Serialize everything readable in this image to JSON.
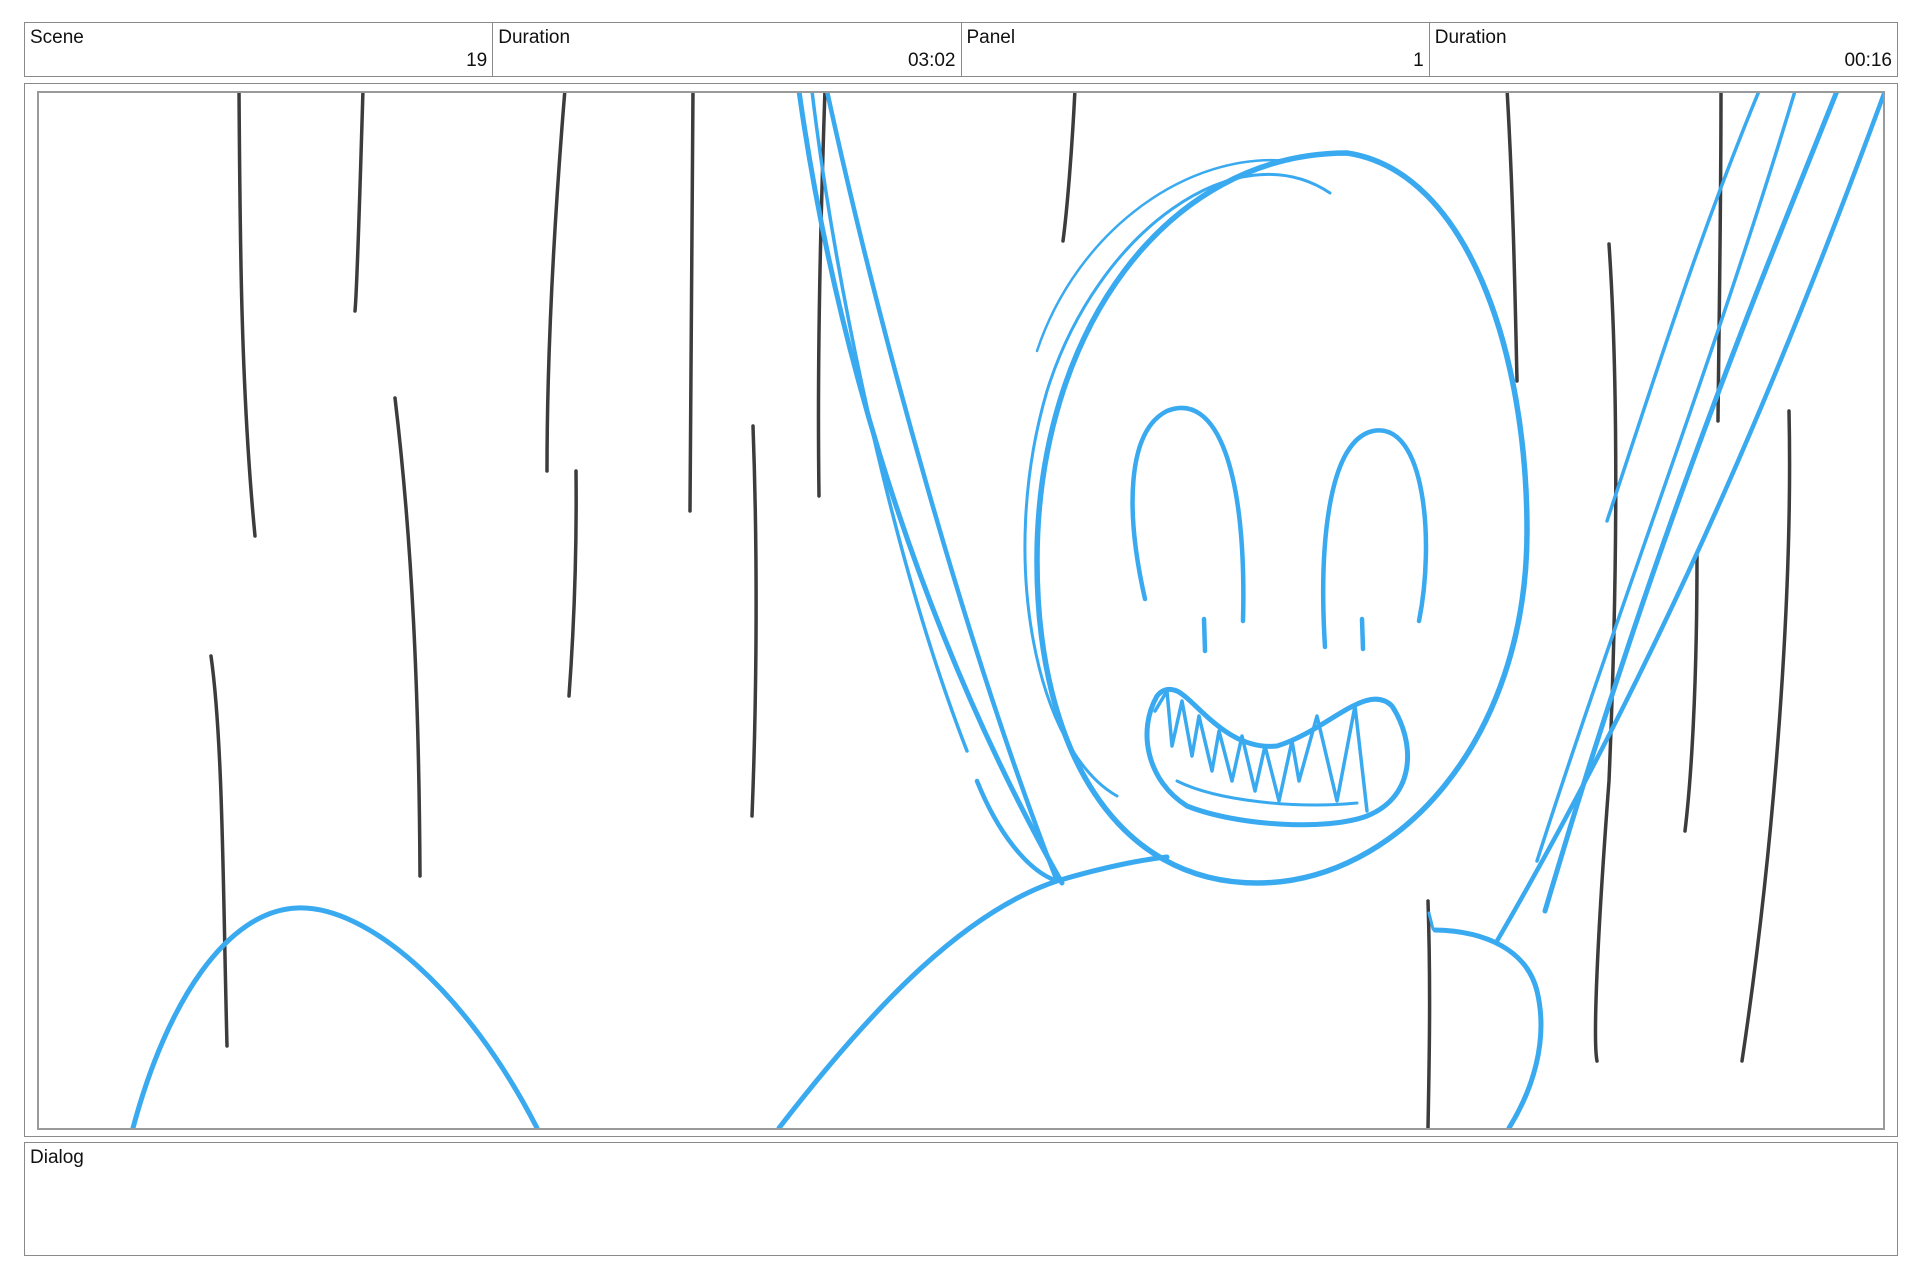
{
  "header": {
    "cells": [
      {
        "label": "Scene",
        "value": "19"
      },
      {
        "label": "Duration",
        "value": "03:02"
      },
      {
        "label": "Panel",
        "value": "1"
      },
      {
        "label": "Duration",
        "value": "00:16"
      }
    ]
  },
  "panel": {
    "sketch_colors": {
      "character": "#3aaaf0",
      "rain": "#3c3c3c"
    }
  },
  "dialog": {
    "label": "Dialog",
    "text": ""
  }
}
